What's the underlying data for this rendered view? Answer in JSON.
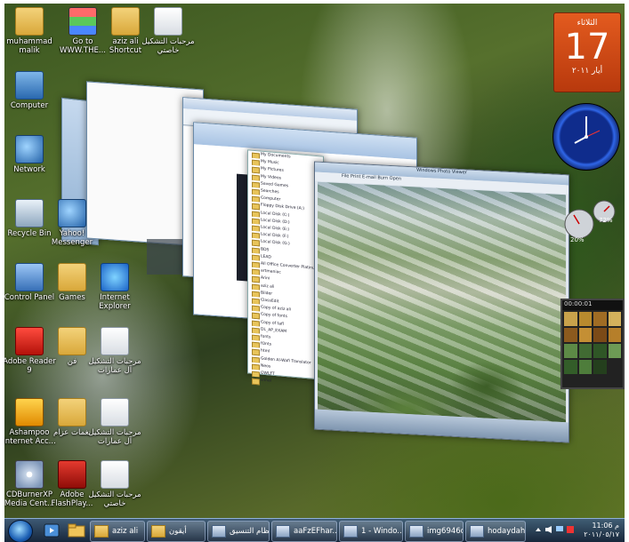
{
  "desktop": {
    "icons": [
      {
        "label": "muhammad malik",
        "icon": "folder-icon"
      },
      {
        "label": "Go to WWW.THE...",
        "icon": "web-shortcut-icon"
      },
      {
        "label": "aziz ali Shortcut",
        "icon": "folder-shortcut-icon"
      },
      {
        "label": "مرحبات التشكيل خاصتي",
        "icon": "document-icon"
      },
      {
        "label": "Computer",
        "icon": "computer-icon"
      },
      {
        "label": "Network",
        "icon": "network-icon"
      },
      {
        "label": "Recycle Bin",
        "icon": "recycle-bin-icon"
      },
      {
        "label": "Yahoo! Messenger",
        "icon": "messenger-icon"
      },
      {
        "label": "Control Panel",
        "icon": "control-panel-icon"
      },
      {
        "label": "Games",
        "icon": "folder-icon"
      },
      {
        "label": "Internet Explorer",
        "icon": "internet-explorer-icon"
      },
      {
        "label": "Adobe Reader 9",
        "icon": "adobe-reader-icon"
      },
      {
        "label": "فن",
        "icon": "folder-icon"
      },
      {
        "label": "مرحبات التشكيل آل عمارات",
        "icon": "document-icon"
      },
      {
        "label": "Ashampoo Internet Acc...",
        "icon": "ashampoo-icon"
      },
      {
        "label": "نغمات عزام",
        "icon": "folder-icon"
      },
      {
        "label": "مرحبات التشكيل آل عمارات",
        "icon": "document-icon"
      },
      {
        "label": "CDBurnerXP Media Cent...",
        "icon": "cd-icon"
      },
      {
        "label": "Adobe FlashPlay...",
        "icon": "flash-icon"
      },
      {
        "label": "مرحبات التشكيل خاصتي",
        "icon": "document-icon"
      }
    ]
  },
  "gadgets": {
    "calendar": {
      "day": "الثلاثاء",
      "date": "17",
      "month": "أيار ٢٠١١"
    },
    "meter": {
      "cpu": "20%",
      "mem": "72%"
    },
    "puzzle": {
      "title": "00:00:01"
    }
  },
  "flip3d": {
    "explorer_tree": [
      "My Documents",
      "My Music",
      "My Pictures",
      "My Videos",
      "Saved Games",
      "Searches",
      "Computer",
      "Floppy Disk Drive (A:)",
      "Local Disk (C:)",
      "Local Disk (D:)",
      "Local Disk (E:)",
      "Local Disk (F:)",
      "Local Disk (G:)",
      "BDS",
      "LEAD",
      "All Office Converter Platinum",
      "artmaniac",
      "Arini",
      "aziz ali",
      "Bilder",
      "ClassEdit",
      "Copy of aziz ali",
      "Copy of fonts",
      "Copy of tafl",
      "DL_AP_EXAM",
      "fonts",
      "fOnts",
      "html",
      "Golden Al-Wafi Translator",
      "Neos",
      "OWLFT",
      "snhal"
    ],
    "photo_title": "Windows Photo Viewer",
    "photo_menu": "File  Print  E-mail  Burn  Open"
  },
  "taskbar": {
    "buttons": [
      {
        "label": "aziz ali",
        "icon": "folder-icon"
      },
      {
        "label": "أيقون",
        "icon": "folder-icon"
      },
      {
        "label": "نظام التنسيق...",
        "icon": "document-icon"
      },
      {
        "label": "aaFzEFhar...",
        "icon": "window-icon"
      },
      {
        "label": "1 - Windo...",
        "icon": "window-icon"
      },
      {
        "label": "img6946cd...",
        "icon": "window-icon"
      },
      {
        "label": "hodaydah...",
        "icon": "window-icon"
      }
    ],
    "time": "11:06 م",
    "date": "٢٠١١/٠٥/١٧"
  }
}
